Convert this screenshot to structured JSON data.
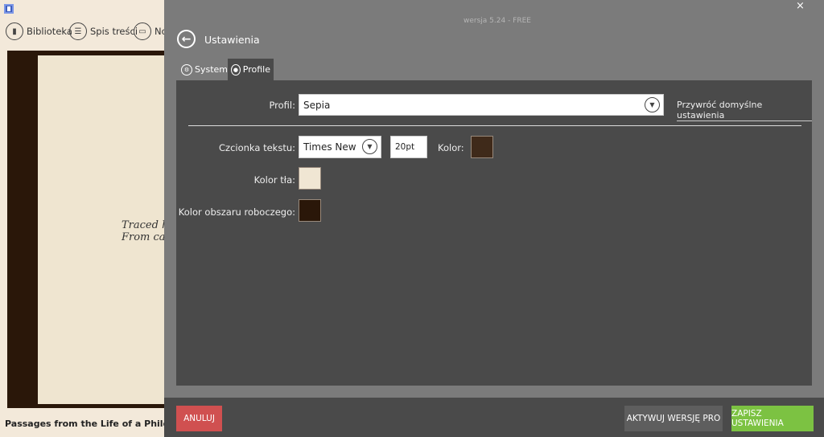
{
  "toolbar": {
    "items": [
      {
        "label": "Biblioteka",
        "icon": "book-icon"
      },
      {
        "label": "Spis treści",
        "icon": "list-icon"
      },
      {
        "label": "No",
        "icon": "notes-icon"
      }
    ]
  },
  "reader": {
    "text_lines": [
      "Traced h",
      "From cal"
    ],
    "book_title": "Passages from the Life of a Philosopher"
  },
  "settings": {
    "version": "wersja 5.24 - FREE",
    "close": "×",
    "title": "Ustawienia",
    "tabs": [
      {
        "label": "System",
        "active": false
      },
      {
        "label": "Profile",
        "active": true
      }
    ],
    "profile_label": "Profil:",
    "profile_value": "Sepia",
    "restore_link": "Przywróć domyślne ustawienia",
    "font_label": "Czcionka tekstu:",
    "font_value": "Times New R",
    "size_value": "20pt",
    "color_label": "Kolor:",
    "text_color": "#3f2a1a",
    "bg_label": "Kolor tła:",
    "bg_color": "#f0e6d3",
    "work_label": "Kolor obszaru roboczego:",
    "work_color": "#2a1709",
    "cancel": "ANULUJ",
    "activate_pro": "AKTYWUJ WERSJĘ PRO",
    "save": "ZAPISZ USTAWIENIA",
    "colors": {
      "cancel": "#d05050",
      "pro": "#5e5e5e",
      "save": "#7cc242"
    }
  }
}
